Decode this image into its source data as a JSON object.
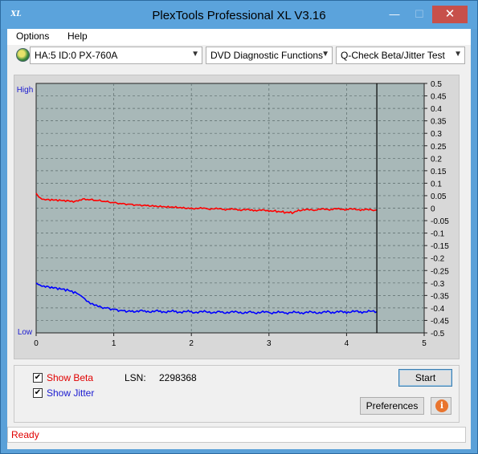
{
  "window": {
    "title": "PlexTools Professional XL V3.16",
    "icon": "XL",
    "minimize_glyph": "—",
    "maximize_glyph": "☐",
    "close_glyph": "✕"
  },
  "menu": {
    "options": "Options",
    "help": "Help"
  },
  "toolbar": {
    "drive": "HA:5 ID:0  PX-760A",
    "function": "DVD Diagnostic Functions",
    "test": "Q-Check Beta/Jitter Test",
    "dropdown_glyph": "▼"
  },
  "chart_data": {
    "type": "line",
    "xlim": [
      0,
      5
    ],
    "x_ticks": [
      "0",
      "1",
      "2",
      "3",
      "4",
      "5"
    ],
    "ylim": [
      -0.5,
      0.5
    ],
    "y_ticks": [
      "0.5",
      "0.45",
      "0.4",
      "0.35",
      "0.3",
      "0.25",
      "0.2",
      "0.15",
      "0.1",
      "0.05",
      "0",
      "-0.05",
      "-0.1",
      "-0.15",
      "-0.2",
      "-0.25",
      "-0.3",
      "-0.35",
      "-0.4",
      "-0.45",
      "-0.5"
    ],
    "left_labels": {
      "top": "High",
      "bottom": "Low"
    },
    "end_marker_x": 4.39,
    "grid": true,
    "background": "#a8b8b8",
    "series": [
      {
        "color": "#ff0000",
        "x": [
          0,
          0.02,
          0.05,
          0.1,
          0.2,
          0.3,
          0.4,
          0.5,
          0.6,
          0.7,
          0.8,
          0.9,
          1.0,
          1.1,
          1.2,
          1.3,
          1.4,
          1.5,
          1.6,
          1.7,
          1.8,
          1.9,
          2.0,
          2.2,
          2.4,
          2.6,
          2.8,
          3.0,
          3.1,
          3.2,
          3.3,
          3.4,
          3.6,
          3.8,
          4.0,
          4.2,
          4.39
        ],
        "y": [
          0.06,
          0.05,
          0.04,
          0.033,
          0.032,
          0.03,
          0.028,
          0.025,
          0.035,
          0.033,
          0.03,
          0.026,
          0.022,
          0.018,
          0.016,
          0.013,
          0.012,
          0.01,
          0.008,
          0.006,
          0.005,
          0.002,
          0.0,
          -0.002,
          -0.004,
          -0.006,
          -0.008,
          -0.01,
          -0.012,
          -0.016,
          -0.018,
          -0.008,
          -0.006,
          -0.004,
          -0.004,
          -0.006,
          -0.008
        ]
      },
      {
        "color": "#0000ff",
        "x": [
          0,
          0.05,
          0.1,
          0.2,
          0.3,
          0.4,
          0.5,
          0.55,
          0.6,
          0.65,
          0.7,
          0.75,
          0.8,
          0.9,
          1.0,
          1.1,
          1.2,
          1.4,
          1.6,
          1.8,
          2.0,
          2.4,
          2.8,
          3.0,
          3.2,
          3.4,
          3.8,
          4.0,
          4.2,
          4.39
        ],
        "y": [
          -0.3,
          -0.31,
          -0.315,
          -0.32,
          -0.325,
          -0.33,
          -0.34,
          -0.35,
          -0.36,
          -0.375,
          -0.385,
          -0.39,
          -0.395,
          -0.4,
          -0.405,
          -0.41,
          -0.412,
          -0.413,
          -0.414,
          -0.415,
          -0.416,
          -0.417,
          -0.418,
          -0.418,
          -0.419,
          -0.419,
          -0.417,
          -0.416,
          -0.415,
          -0.415
        ]
      }
    ]
  },
  "options": {
    "show_beta": "Show Beta",
    "show_beta_color": "#e00000",
    "show_jitter": "Show Jitter",
    "show_jitter_color": "#1a1ad0",
    "checked_glyph": "✔",
    "lsn_label": "LSN:",
    "lsn_value": "2298368"
  },
  "buttons": {
    "start": "Start",
    "preferences": "Preferences",
    "info_glyph": "i"
  },
  "status": {
    "text": "Ready"
  }
}
